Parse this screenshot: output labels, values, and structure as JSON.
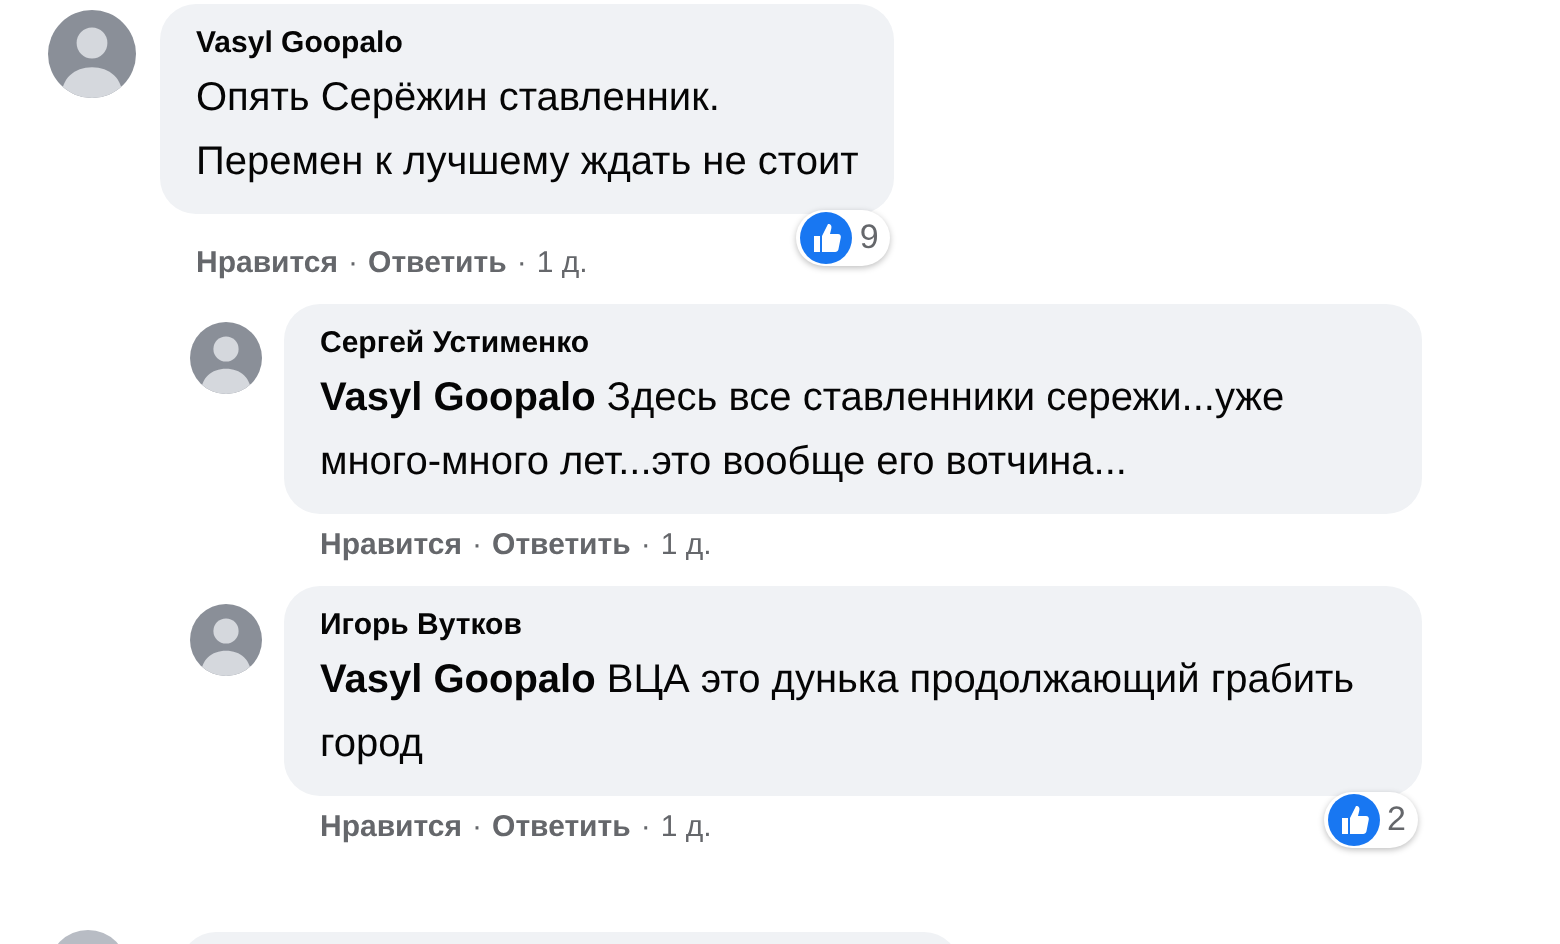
{
  "comments": [
    {
      "author": "Vasyl Goopalo",
      "text": "Опять Серёжин ставленник.\nПеремен к лучшему ждать не стоит",
      "reactions": {
        "count": "9"
      },
      "actions": [
        {
          "kind": "link",
          "label": "Нравится"
        },
        {
          "kind": "separator",
          "label": "·"
        },
        {
          "kind": "link",
          "label": "Ответить"
        },
        {
          "kind": "separator",
          "label": "·"
        },
        {
          "kind": "time",
          "label": "1 д."
        }
      ],
      "replies": [
        {
          "author": "Сергей Устименко",
          "text": "**Vasyl Goopalo** Здесь все ставленники сережи...уже много-много лет...это вообще его вотчина...",
          "actions": [
            {
              "kind": "link",
              "label": "Нравится"
            },
            {
              "kind": "separator",
              "label": "·"
            },
            {
              "kind": "link",
              "label": "Ответить"
            },
            {
              "kind": "separator",
              "label": "·"
            },
            {
              "kind": "time",
              "label": "1 д."
            }
          ]
        },
        {
          "author": "Игорь Вутков",
          "text": "**Vasyl Goopalo** ВЦА это дунька продолжающий грабить город",
          "reactions": {
            "count": "2"
          },
          "actions": [
            {
              "kind": "link",
              "label": "Нравится"
            },
            {
              "kind": "separator",
              "label": "·"
            },
            {
              "kind": "link",
              "label": "Ответить"
            },
            {
              "kind": "separator",
              "label": "·"
            },
            {
              "kind": "time",
              "label": "1 д."
            }
          ]
        }
      ]
    }
  ]
}
